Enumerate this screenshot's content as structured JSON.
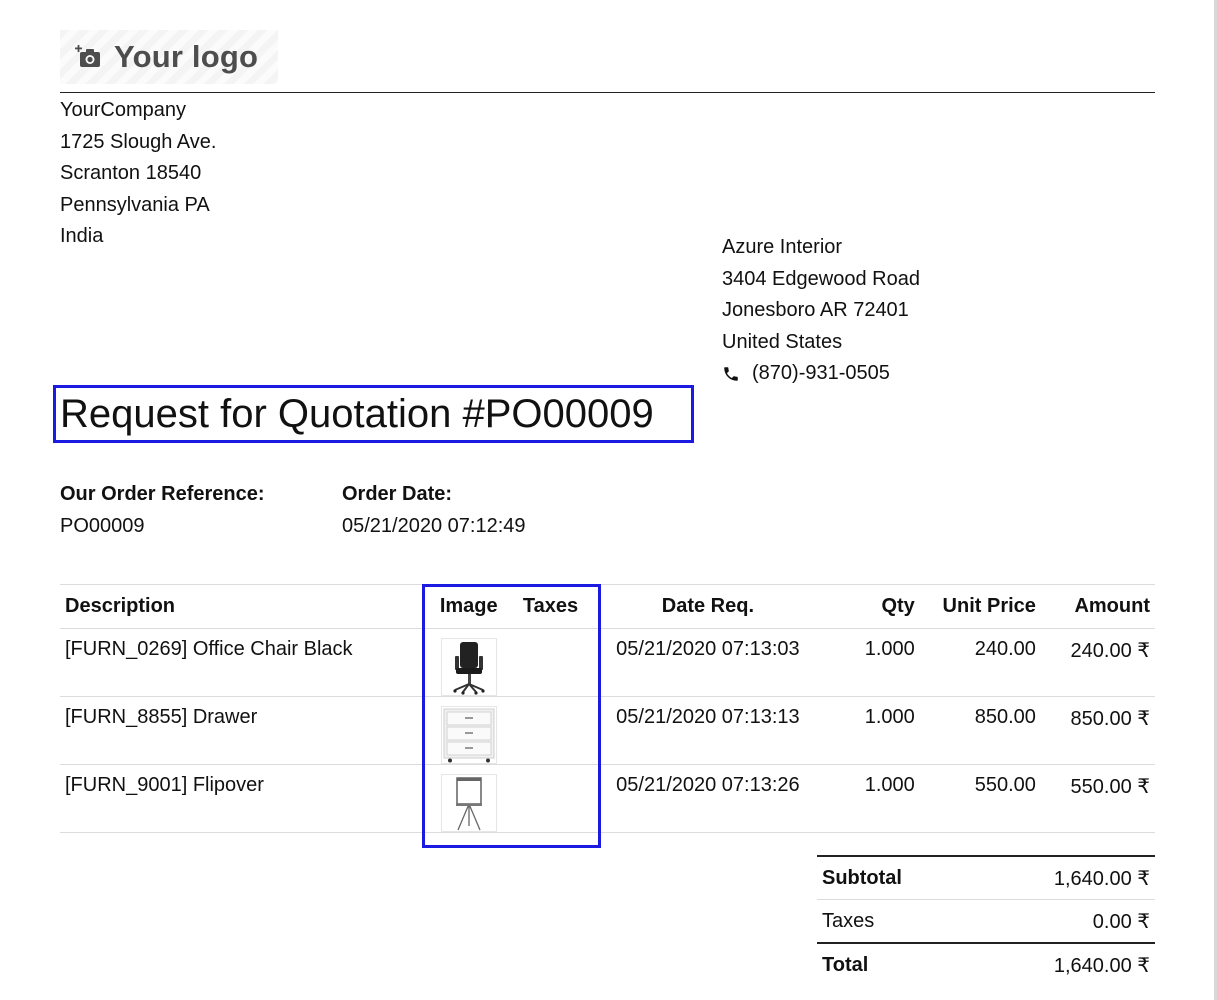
{
  "header": {
    "logo_text": "Your logo",
    "logo_icon": "camera-plus-icon"
  },
  "company": {
    "lines": [
      "YourCompany",
      "1725 Slough Ave.",
      "Scranton 18540",
      "Pennsylvania PA",
      "India"
    ]
  },
  "partner": {
    "lines": [
      "Azure Interior",
      "3404 Edgewood Road",
      "Jonesboro AR 72401",
      "United States"
    ],
    "phone": "(870)-931-0505",
    "phone_icon": "phone-icon"
  },
  "document": {
    "title": "Request for Quotation #PO00009",
    "order_ref_label": "Our Order Reference:",
    "order_ref": "PO00009",
    "order_date_label": "Order Date:",
    "order_date": "05/21/2020 07:12:49"
  },
  "table": {
    "headers": {
      "description": "Description",
      "image": "Image",
      "taxes": "Taxes",
      "date_req": "Date Req.",
      "qty": "Qty",
      "unit_price": "Unit Price",
      "amount": "Amount"
    },
    "rows": [
      {
        "description": "[FURN_0269] Office Chair Black",
        "image": "office-chair-image",
        "taxes": "",
        "date_req": "05/21/2020 07:13:03",
        "qty": "1.000",
        "unit_price": "240.00",
        "amount": "240.00 ₹"
      },
      {
        "description": "[FURN_8855] Drawer",
        "image": "drawer-image",
        "taxes": "",
        "date_req": "05/21/2020 07:13:13",
        "qty": "1.000",
        "unit_price": "850.00",
        "amount": "850.00 ₹"
      },
      {
        "description": "[FURN_9001] Flipover",
        "image": "flipover-image",
        "taxes": "",
        "date_req": "05/21/2020 07:13:26",
        "qty": "1.000",
        "unit_price": "550.00",
        "amount": "550.00 ₹"
      }
    ]
  },
  "totals": {
    "subtotal_label": "Subtotal",
    "subtotal": "1,640.00 ₹",
    "taxes_label": "Taxes",
    "taxes": "0.00 ₹",
    "total_label": "Total",
    "total": "1,640.00 ₹"
  },
  "colors": {
    "highlight": "#1a1ae0",
    "rule": "#222222",
    "row_border": "#dcdcdc"
  }
}
